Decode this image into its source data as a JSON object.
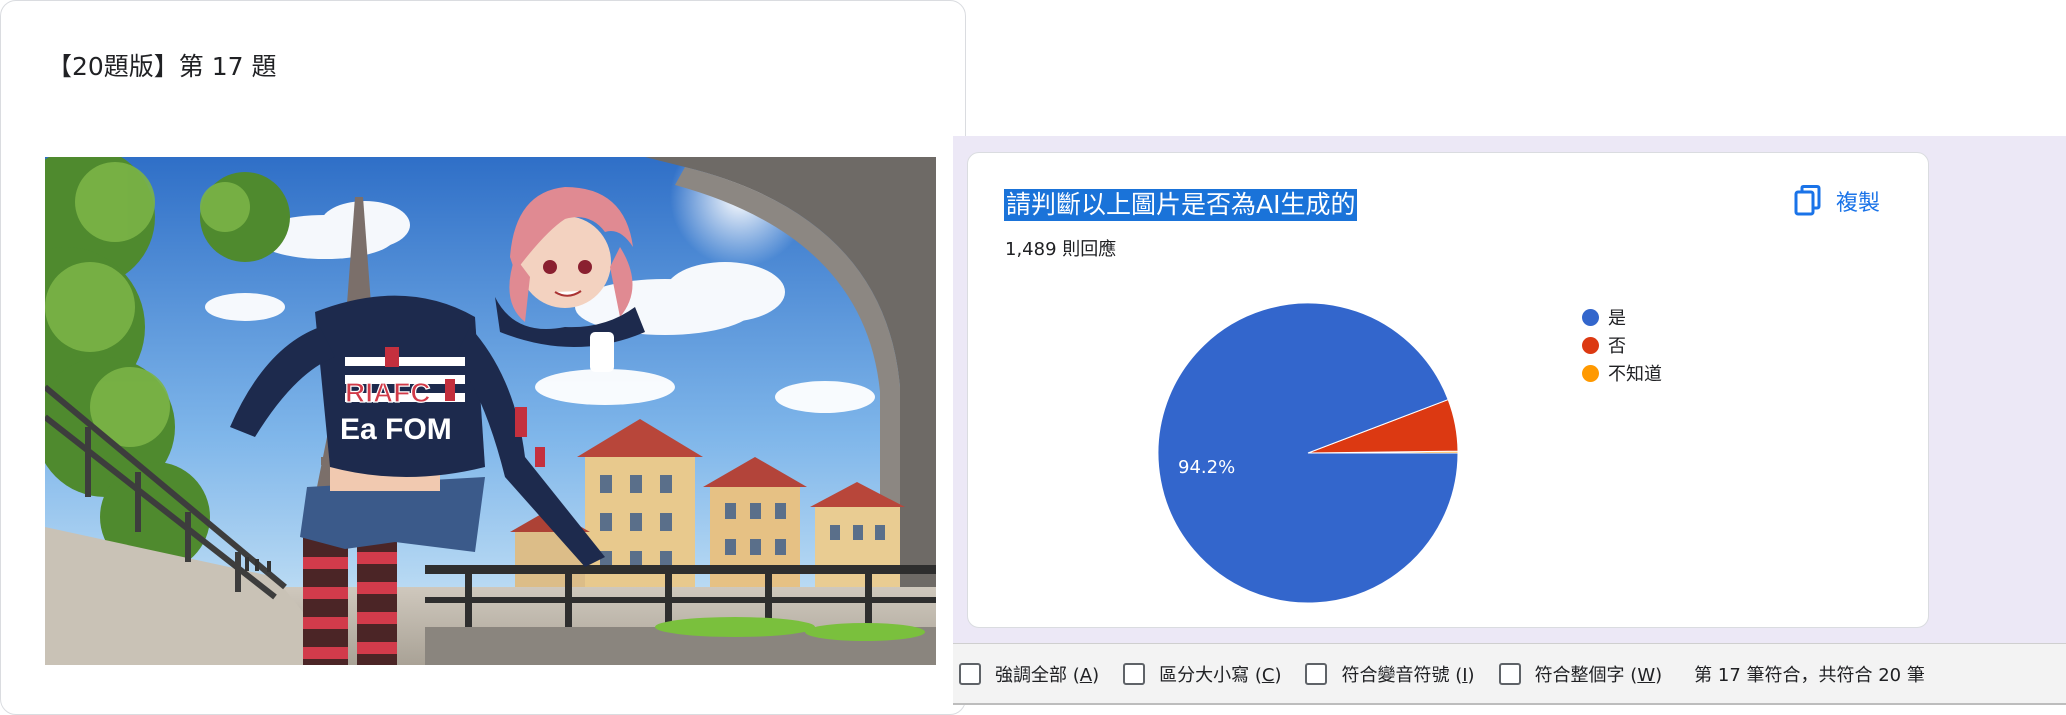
{
  "question_card": {
    "title": "【20題版】第 17 題",
    "image_alt": "anime girl in hoodie on a bridge in front of the Eiffel Tower"
  },
  "results": {
    "question": "請判斷以上圖片是否為AI生成的",
    "response_count": "1,489 則回應",
    "copy_label": "複製",
    "highlight_color": "#1a73d9"
  },
  "chart_data": {
    "type": "pie",
    "categories": [
      "是",
      "否",
      "不知道"
    ],
    "values": [
      94.2,
      5.6,
      0.2
    ],
    "colors": [
      "#3366cc",
      "#dc3912",
      "#ff9900"
    ],
    "data_labels": [
      "94.2%",
      "",
      ""
    ],
    "legend_position": "right"
  },
  "find_bar": {
    "options": [
      {
        "prefix": "強調全部 (",
        "accel": "A",
        "suffix": ")"
      },
      {
        "prefix": "區分大小寫 (",
        "accel": "C",
        "suffix": ")"
      },
      {
        "prefix": "符合變音符號 (",
        "accel": "I",
        "suffix": ")"
      },
      {
        "prefix": "符合整個字 (",
        "accel": "W",
        "suffix": ")"
      }
    ],
    "status": "第 17 筆符合，共符合 20 筆"
  }
}
